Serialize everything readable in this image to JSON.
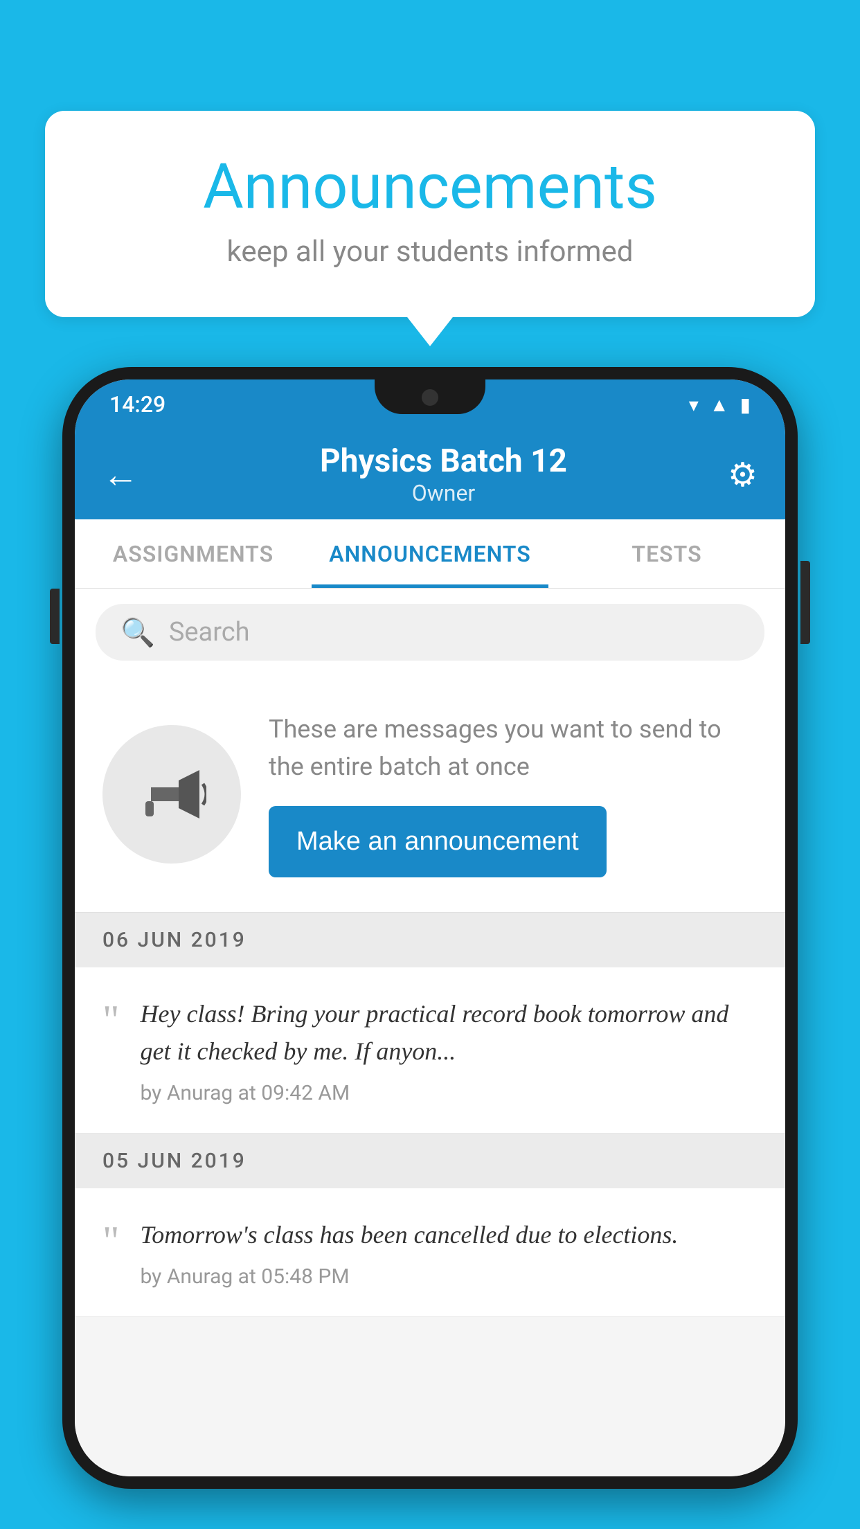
{
  "background_color": "#1ab8e8",
  "speech_bubble": {
    "title": "Announcements",
    "subtitle": "keep all your students informed"
  },
  "phone": {
    "status_bar": {
      "time": "14:29",
      "icons": [
        "wifi",
        "signal",
        "battery"
      ]
    },
    "app_bar": {
      "title": "Physics Batch 12",
      "subtitle": "Owner",
      "back_label": "←",
      "gear_label": "⚙"
    },
    "tabs": [
      {
        "label": "ASSIGNMENTS",
        "active": false
      },
      {
        "label": "ANNOUNCEMENTS",
        "active": true
      },
      {
        "label": "TESTS",
        "active": false
      }
    ],
    "search": {
      "placeholder": "Search"
    },
    "announcement_prompt": {
      "description": "These are messages you want to send to the entire batch at once",
      "button_label": "Make an announcement"
    },
    "date_groups": [
      {
        "date": "06  JUN  2019",
        "items": [
          {
            "message": "Hey class! Bring your practical record book tomorrow and get it checked by me. If anyon...",
            "meta": "by Anurag at 09:42 AM"
          }
        ]
      },
      {
        "date": "05  JUN  2019",
        "items": [
          {
            "message": "Tomorrow's class has been cancelled due to elections.",
            "meta": "by Anurag at 05:48 PM"
          }
        ]
      }
    ]
  }
}
